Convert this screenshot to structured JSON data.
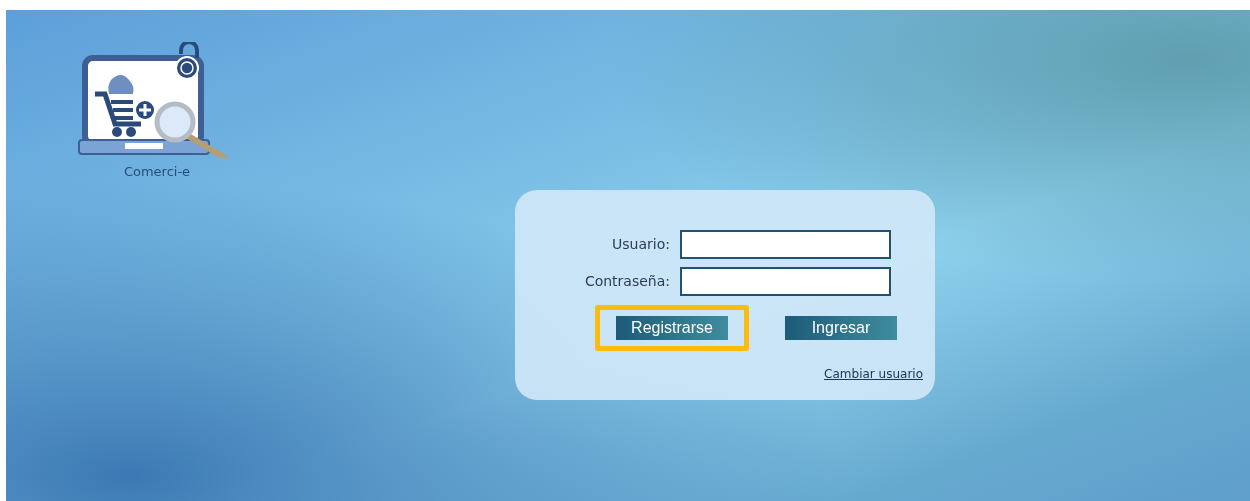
{
  "logo": {
    "caption": "Comerci-e"
  },
  "login_form": {
    "fields": [
      {
        "label": "Usuario:"
      },
      {
        "label": "Contraseña:"
      }
    ],
    "buttons": [
      {
        "label": "Registrarse",
        "highlighted": true
      },
      {
        "label": "Ingresar",
        "highlighted": false
      }
    ],
    "link": "Cambiar usuario"
  }
}
